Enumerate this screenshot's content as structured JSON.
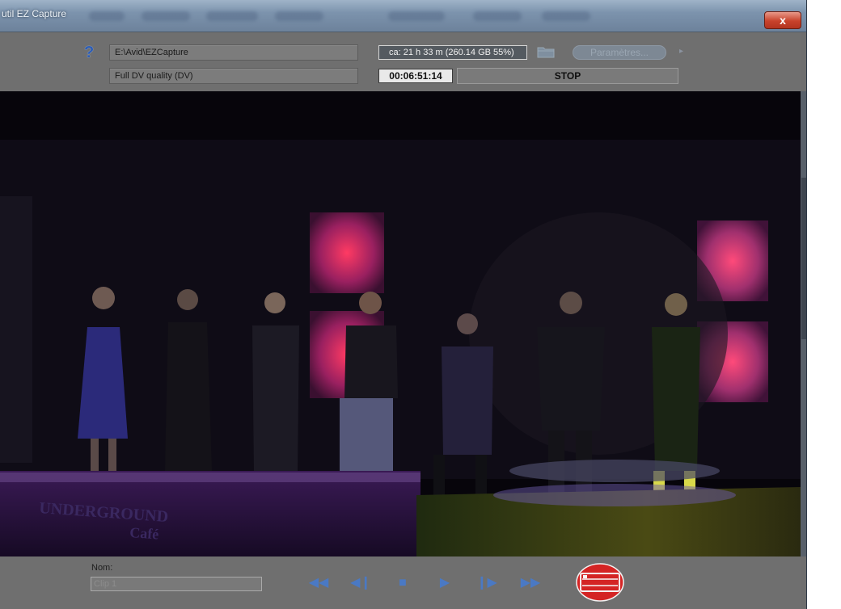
{
  "window": {
    "title": "util EZ Capture",
    "close_label": "x"
  },
  "topbar": {
    "help_glyph": "?",
    "path_value": "E:\\Avid\\EZCapture",
    "quality_value": "Full DV quality  (DV)",
    "disk_info": "ca: 21 h 33 m  (260.14 GB  55%)",
    "folder_icon": "folder-icon",
    "params_label": "Paramètres...",
    "params_arrow": "▸",
    "timecode": "00:06:51:14",
    "stop_label": "STOP"
  },
  "video": {
    "stage_sign_line1": "UNDERGROUND",
    "stage_sign_line2": "Café"
  },
  "bottombar": {
    "nom_label": "Nom:",
    "clip_name": "Clip 1",
    "transport": {
      "rewind": "◀◀",
      "step_back": "◀❙",
      "stop": "■",
      "play": "▶",
      "step_forward": "❙▶",
      "fast_forward": "▶▶"
    },
    "record_icon": "record-icon"
  },
  "colors": {
    "accent_blue": "#4a79c4",
    "record_red": "#d42424",
    "help_blue": "#2d5db5"
  }
}
